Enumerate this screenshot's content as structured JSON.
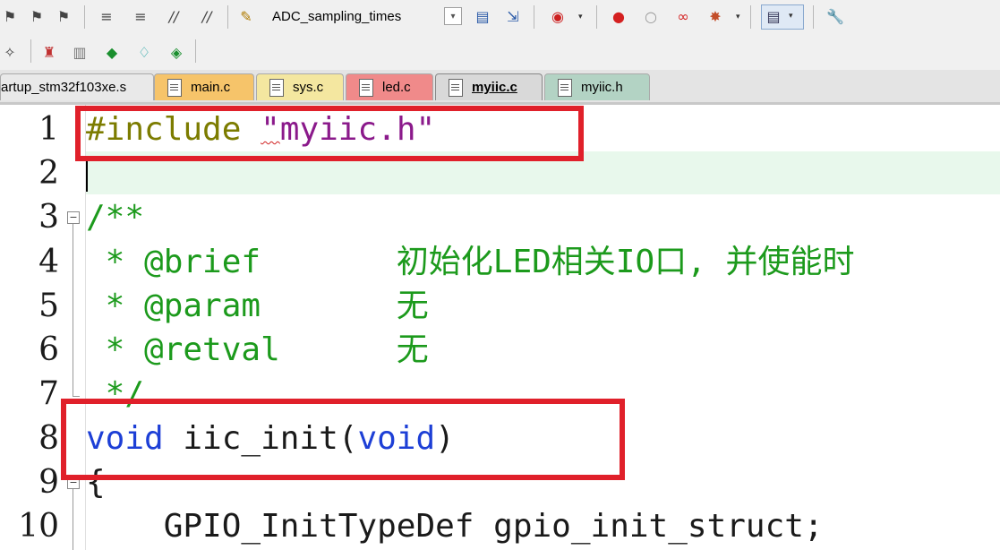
{
  "toolbar1": {
    "config_combo_value": "ADC_sampling_times",
    "icons": [
      "bookmark-prev-icon",
      "bookmark-next-icon",
      "bookmark-clear-icon",
      "indent-icon",
      "unindent-icon",
      "comment-icon",
      "uncomment-icon",
      "target-options-icon",
      "combo-dropdown-icon",
      "build-icon",
      "download-icon",
      "debug-session-icon",
      "breakpoint-insert-icon",
      "breakpoint-disable-icon",
      "breakpoint-clear-icon",
      "breakpoint-kill-icon",
      "window-layout-icon",
      "configure-icon"
    ]
  },
  "toolbar2": {
    "icons": [
      "magic-wand-icon",
      "manage-project-icon",
      "books-icon",
      "packs-icon",
      "pack-installer-icon",
      "rte-icon"
    ]
  },
  "tabs": [
    {
      "label": "artup_stm32f103xe.s",
      "color": "#e9e9e9",
      "active": false
    },
    {
      "label": "main.c",
      "color": "#f6c46a",
      "active": false
    },
    {
      "label": "sys.c",
      "color": "#f4e7a0",
      "active": false
    },
    {
      "label": "led.c",
      "color": "#f08a8a",
      "active": false
    },
    {
      "label": "myiic.c",
      "color": "#d9d9d9",
      "active": true
    },
    {
      "label": "myiic.h",
      "color": "#b3d3c4",
      "active": false
    }
  ],
  "editor": {
    "line_numbers": [
      "1",
      "2",
      "3",
      "4",
      "5",
      "6",
      "7",
      "8",
      "9",
      "10"
    ],
    "lines": {
      "l1_directive": "#include",
      "l1_q1": "\"",
      "l1_file": "myiic",
      "l1_rest": ".h\"",
      "l3": "/**",
      "l4": " * @brief       初始化LED相关IO口, 并使能时",
      "l5": " * @param       无",
      "l6": " * @retval      无",
      "l7": " */",
      "l8_kw1": "void",
      "l8_name": " iic_init(",
      "l8_kw2": "void",
      "l8_close": ")",
      "l9": "{",
      "l10": "    GPIO_InitTypeDef gpio_init_struct;"
    }
  },
  "colors": {
    "highlight_box": "#e0202a",
    "keyword": "#1d3fd6",
    "comment": "#1c9a1c",
    "preprocessor": "#7c7c00",
    "string": "#8b1a8b",
    "current_line": "#e8f8ec"
  }
}
